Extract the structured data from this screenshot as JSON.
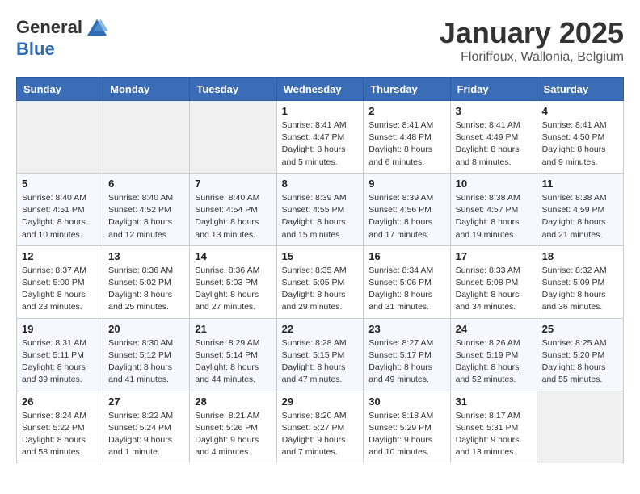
{
  "header": {
    "logo_general": "General",
    "logo_blue": "Blue",
    "month_title": "January 2025",
    "location": "Floriffoux, Wallonia, Belgium"
  },
  "days_of_week": [
    "Sunday",
    "Monday",
    "Tuesday",
    "Wednesday",
    "Thursday",
    "Friday",
    "Saturday"
  ],
  "weeks": [
    [
      {
        "day": "",
        "info": ""
      },
      {
        "day": "",
        "info": ""
      },
      {
        "day": "",
        "info": ""
      },
      {
        "day": "1",
        "info": "Sunrise: 8:41 AM\nSunset: 4:47 PM\nDaylight: 8 hours\nand 5 minutes."
      },
      {
        "day": "2",
        "info": "Sunrise: 8:41 AM\nSunset: 4:48 PM\nDaylight: 8 hours\nand 6 minutes."
      },
      {
        "day": "3",
        "info": "Sunrise: 8:41 AM\nSunset: 4:49 PM\nDaylight: 8 hours\nand 8 minutes."
      },
      {
        "day": "4",
        "info": "Sunrise: 8:41 AM\nSunset: 4:50 PM\nDaylight: 8 hours\nand 9 minutes."
      }
    ],
    [
      {
        "day": "5",
        "info": "Sunrise: 8:40 AM\nSunset: 4:51 PM\nDaylight: 8 hours\nand 10 minutes."
      },
      {
        "day": "6",
        "info": "Sunrise: 8:40 AM\nSunset: 4:52 PM\nDaylight: 8 hours\nand 12 minutes."
      },
      {
        "day": "7",
        "info": "Sunrise: 8:40 AM\nSunset: 4:54 PM\nDaylight: 8 hours\nand 13 minutes."
      },
      {
        "day": "8",
        "info": "Sunrise: 8:39 AM\nSunset: 4:55 PM\nDaylight: 8 hours\nand 15 minutes."
      },
      {
        "day": "9",
        "info": "Sunrise: 8:39 AM\nSunset: 4:56 PM\nDaylight: 8 hours\nand 17 minutes."
      },
      {
        "day": "10",
        "info": "Sunrise: 8:38 AM\nSunset: 4:57 PM\nDaylight: 8 hours\nand 19 minutes."
      },
      {
        "day": "11",
        "info": "Sunrise: 8:38 AM\nSunset: 4:59 PM\nDaylight: 8 hours\nand 21 minutes."
      }
    ],
    [
      {
        "day": "12",
        "info": "Sunrise: 8:37 AM\nSunset: 5:00 PM\nDaylight: 8 hours\nand 23 minutes."
      },
      {
        "day": "13",
        "info": "Sunrise: 8:36 AM\nSunset: 5:02 PM\nDaylight: 8 hours\nand 25 minutes."
      },
      {
        "day": "14",
        "info": "Sunrise: 8:36 AM\nSunset: 5:03 PM\nDaylight: 8 hours\nand 27 minutes."
      },
      {
        "day": "15",
        "info": "Sunrise: 8:35 AM\nSunset: 5:05 PM\nDaylight: 8 hours\nand 29 minutes."
      },
      {
        "day": "16",
        "info": "Sunrise: 8:34 AM\nSunset: 5:06 PM\nDaylight: 8 hours\nand 31 minutes."
      },
      {
        "day": "17",
        "info": "Sunrise: 8:33 AM\nSunset: 5:08 PM\nDaylight: 8 hours\nand 34 minutes."
      },
      {
        "day": "18",
        "info": "Sunrise: 8:32 AM\nSunset: 5:09 PM\nDaylight: 8 hours\nand 36 minutes."
      }
    ],
    [
      {
        "day": "19",
        "info": "Sunrise: 8:31 AM\nSunset: 5:11 PM\nDaylight: 8 hours\nand 39 minutes."
      },
      {
        "day": "20",
        "info": "Sunrise: 8:30 AM\nSunset: 5:12 PM\nDaylight: 8 hours\nand 41 minutes."
      },
      {
        "day": "21",
        "info": "Sunrise: 8:29 AM\nSunset: 5:14 PM\nDaylight: 8 hours\nand 44 minutes."
      },
      {
        "day": "22",
        "info": "Sunrise: 8:28 AM\nSunset: 5:15 PM\nDaylight: 8 hours\nand 47 minutes."
      },
      {
        "day": "23",
        "info": "Sunrise: 8:27 AM\nSunset: 5:17 PM\nDaylight: 8 hours\nand 49 minutes."
      },
      {
        "day": "24",
        "info": "Sunrise: 8:26 AM\nSunset: 5:19 PM\nDaylight: 8 hours\nand 52 minutes."
      },
      {
        "day": "25",
        "info": "Sunrise: 8:25 AM\nSunset: 5:20 PM\nDaylight: 8 hours\nand 55 minutes."
      }
    ],
    [
      {
        "day": "26",
        "info": "Sunrise: 8:24 AM\nSunset: 5:22 PM\nDaylight: 8 hours\nand 58 minutes."
      },
      {
        "day": "27",
        "info": "Sunrise: 8:22 AM\nSunset: 5:24 PM\nDaylight: 9 hours\nand 1 minute."
      },
      {
        "day": "28",
        "info": "Sunrise: 8:21 AM\nSunset: 5:26 PM\nDaylight: 9 hours\nand 4 minutes."
      },
      {
        "day": "29",
        "info": "Sunrise: 8:20 AM\nSunset: 5:27 PM\nDaylight: 9 hours\nand 7 minutes."
      },
      {
        "day": "30",
        "info": "Sunrise: 8:18 AM\nSunset: 5:29 PM\nDaylight: 9 hours\nand 10 minutes."
      },
      {
        "day": "31",
        "info": "Sunrise: 8:17 AM\nSunset: 5:31 PM\nDaylight: 9 hours\nand 13 minutes."
      },
      {
        "day": "",
        "info": ""
      }
    ]
  ]
}
